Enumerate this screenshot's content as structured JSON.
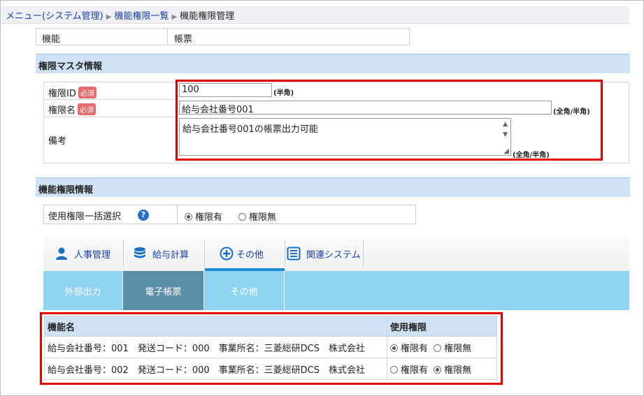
{
  "breadcrumb": {
    "items": [
      "メニュー(システム管理)",
      "機能権限一覧",
      "機能権限管理"
    ]
  },
  "function_row": {
    "label": "機能",
    "value": "帳票"
  },
  "master_section": {
    "title": "権限マスタ情報",
    "required_badge": "必須",
    "id_label": "権限ID",
    "id_value": "100",
    "id_note": "(半角)",
    "name_label": "権限名",
    "name_value": "給与会社番号001",
    "name_note": "(全角/半角)",
    "remarks_label": "備考",
    "remarks_value": "給与会社番号001の帳票出力可能",
    "remarks_note": "(全角/半角)"
  },
  "function_section": {
    "title": "機能権限情報",
    "bulk_label": "使用権限一括選択",
    "opt_yes": "権限有",
    "opt_no": "権限無",
    "bulk_selected": "権限有"
  },
  "tabs": [
    {
      "label": "人事管理",
      "icon": "person-icon"
    },
    {
      "label": "給与計算",
      "icon": "database-icon"
    },
    {
      "label": "その他",
      "icon": "plus-circle-icon"
    },
    {
      "label": "関連システム",
      "icon": "list-icon"
    }
  ],
  "active_tab": "その他",
  "subtabs": [
    "外部出力",
    "電子帳票",
    "その他"
  ],
  "active_subtab": "電子帳票",
  "table": {
    "headers": [
      "機能名",
      "使用権限"
    ],
    "rows": [
      {
        "name": "給与会社番号：001　発送コード：000　事業所名：三菱総研DCS　株式会社",
        "selected": "権限有"
      },
      {
        "name": "給与会社番号：002　発送コード：000　事業所名：三菱総研DCS　株式会社",
        "selected": "権限無"
      }
    ]
  },
  "colors": {
    "highlight": "#e00000",
    "tab_accent": "#1a8fd8",
    "subtab_bg": "#8fd3f2",
    "subtab_active": "#5b8ea8"
  }
}
